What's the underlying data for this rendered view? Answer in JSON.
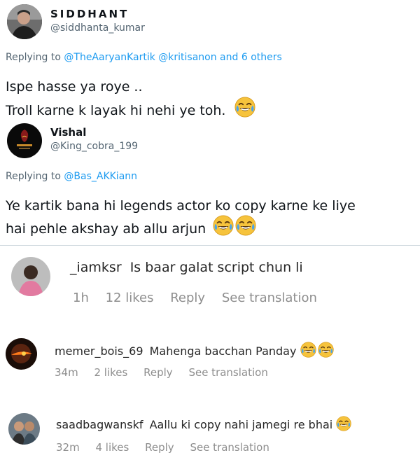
{
  "tweet1": {
    "name": "SIDDHANT",
    "handle": "@siddhanta_kumar",
    "replying_prefix": "Replying to",
    "replying_to": "@TheAaryanKartik @kritisanon and 6 others",
    "line1": "Ispe hasse ya roye ..",
    "line2": "Troll karne k layak hi nehi ye toh.",
    "emoji": "face-with-tears-of-joy-icon"
  },
  "tweet2": {
    "name": "Vishal",
    "handle": "@King_cobra_199",
    "replying_prefix": "Replying to",
    "replying_to": "@Bas_AKKiann",
    "line1": "Ye kartik bana hi legends actor ko copy karne ke liye",
    "line2": "hai pehle akshay ab allu arjun"
  },
  "comments": [
    {
      "username": "_iamksr",
      "text": "Is baar galat script chun li",
      "time": "1h",
      "likes": "12 likes",
      "reply": "Reply",
      "translate": "See translation"
    },
    {
      "username": "memer_bois_69",
      "text": "Mahenga bacchan Panday",
      "time": "34m",
      "likes": "2 likes",
      "reply": "Reply",
      "translate": "See translation"
    },
    {
      "username": "saadbagwanskf",
      "text": "Aallu ki copy nahi jamegi re bhai",
      "time": "32m",
      "likes": "4 likes",
      "reply": "Reply",
      "translate": "See translation"
    }
  ],
  "colors": {
    "link": "#1d9bf0",
    "muted": "#536471",
    "ig_muted": "#8e8e8e",
    "emoji": "#f6c33c"
  }
}
